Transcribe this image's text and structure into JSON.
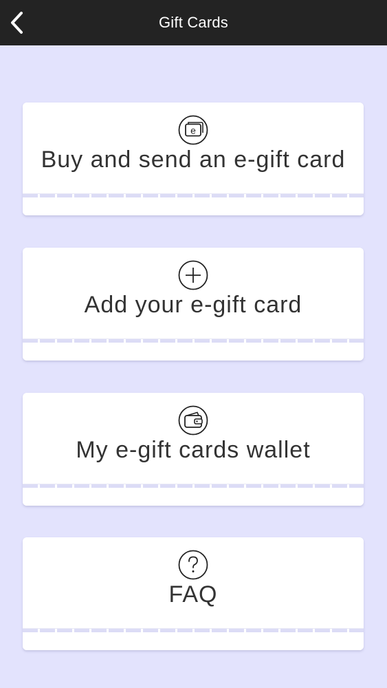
{
  "header": {
    "title": "Gift Cards",
    "back_icon": "chevron-left-icon"
  },
  "menu": [
    {
      "label": "Buy and send an e-gift card",
      "icon": "e-card-icon"
    },
    {
      "label": "Add your e-gift card",
      "icon": "plus-circle-icon"
    },
    {
      "label": "My e-gift cards wallet",
      "icon": "wallet-icon"
    },
    {
      "label": "FAQ",
      "icon": "question-circle-icon"
    }
  ],
  "colors": {
    "header_bg": "#232323",
    "page_bg": "#e3e3fd",
    "card_bg": "#ffffff",
    "text": "#333333"
  }
}
